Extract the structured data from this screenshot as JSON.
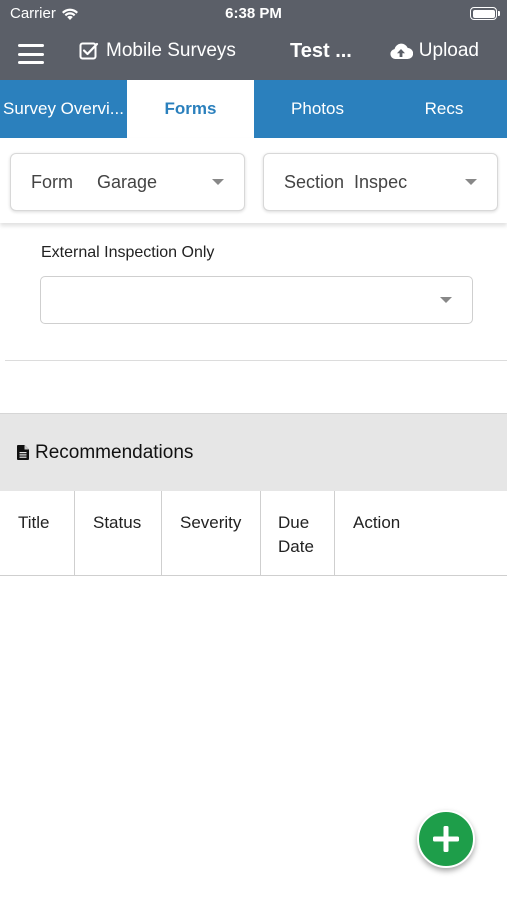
{
  "status_bar": {
    "carrier": "Carrier",
    "time": "6:38 PM"
  },
  "nav": {
    "app_title": "Mobile Surveys",
    "survey_title": "Test ...",
    "upload_label": "Upload"
  },
  "tabs": [
    {
      "label": "Survey Overvi...",
      "active": false
    },
    {
      "label": "Forms",
      "active": true
    },
    {
      "label": "Photos",
      "active": false
    },
    {
      "label": "Recs",
      "active": false
    }
  ],
  "pickers": {
    "form": {
      "label": "Form",
      "value": "Garage"
    },
    "section": {
      "label": "Section",
      "value": "Inspec"
    }
  },
  "question": {
    "label": "External Inspection Only",
    "value": ""
  },
  "recommendations": {
    "title": "Recommendations",
    "columns": [
      "Title",
      "Status",
      "Severity",
      "Due Date",
      "Action"
    ]
  },
  "colors": {
    "header": "#5b5f68",
    "tabs": "#2b80bd",
    "fab": "#1e9e4a",
    "section_bg": "#e6e6e6"
  },
  "icons": {
    "menu": "hamburger-icon",
    "app": "checkbox-icon",
    "upload": "cloud-upload-icon",
    "wifi": "wifi-icon",
    "battery": "battery-icon",
    "document": "document-icon",
    "dropdown": "caret-down-icon",
    "add": "plus-icon"
  }
}
